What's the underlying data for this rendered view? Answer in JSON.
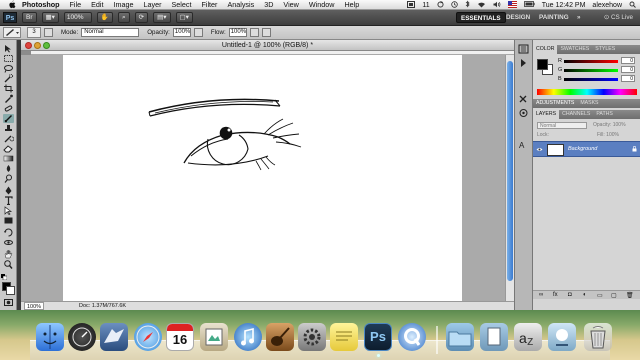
{
  "menubar": {
    "app_name": "Photoshop",
    "items": [
      "File",
      "Edit",
      "Image",
      "Layer",
      "Select",
      "Filter",
      "Analysis",
      "3D",
      "View",
      "Window",
      "Help"
    ],
    "status_number": "11",
    "clock": "Tue 12:42 PM",
    "user": "alexehow"
  },
  "appbar": {
    "logo": "Ps",
    "zoom": "100%",
    "workspaces": [
      "ESSENTIALS",
      "DESIGN",
      "PAINTING"
    ],
    "workspace_more": "»",
    "cs_live": "CS Live"
  },
  "options": {
    "brush_size": "3",
    "mode_label": "Mode:",
    "mode_value": "Normal",
    "opacity_label": "Opacity:",
    "opacity_value": "100%",
    "flow_label": "Flow:",
    "flow_value": "100%"
  },
  "document": {
    "title": "Untitled-1 @ 100% (RGB/8) *",
    "zoom": "100%",
    "doc_info": "Doc: 1.37M/767.6K"
  },
  "panels": {
    "color_tabs": [
      "COLOR",
      "SWATCHES",
      "STYLES"
    ],
    "color_values": {
      "R": "0",
      "G": "0",
      "B": "0"
    },
    "adjust_tabs": [
      "ADJUSTMENTS",
      "MASKS"
    ],
    "layers_tabs": [
      "LAYERS",
      "CHANNELS",
      "PATHS"
    ],
    "blend_mode": "Normal",
    "opacity": "Opacity: 100%",
    "lock": "Lock:",
    "fill": "Fill: 100%",
    "layer_name": "Background"
  },
  "dock": {
    "calendar_day": "16",
    "photoshop": "Ps"
  }
}
